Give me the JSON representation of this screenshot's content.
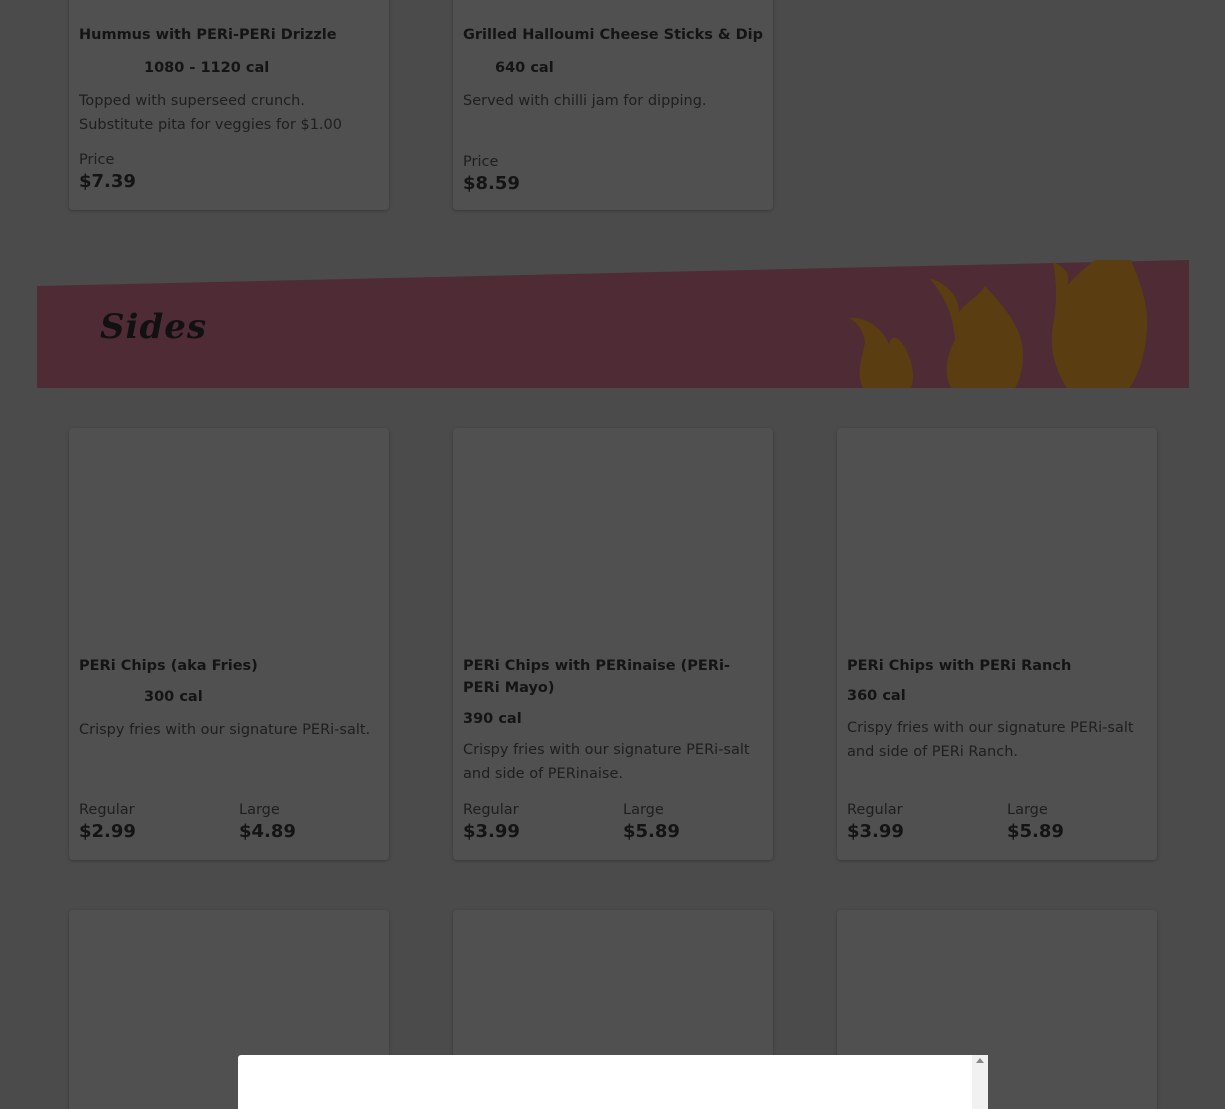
{
  "top_items": [
    {
      "name": "Hummus with PERi-PERi Drizzle",
      "cal": "1080 - 1120 cal",
      "desc": "Topped with superseed crunch. Substitute pita for veggies for $1.00",
      "price_label": "Price",
      "price": "$7.39"
    },
    {
      "name": "Grilled Halloumi Cheese Sticks & Dip",
      "cal": "640 cal",
      "desc": "Served with chilli jam for dipping.",
      "price_label": "Price",
      "price": "$8.59"
    }
  ],
  "sides": {
    "title": "Sides",
    "items": [
      {
        "name": "PERi Chips (aka Fries)",
        "cal": "300 cal",
        "desc": "Crispy fries with our signature PERi-salt.",
        "regular_label": "Regular",
        "regular_price": "$2.99",
        "large_label": "Large",
        "large_price": "$4.89"
      },
      {
        "name": "PERi Chips with PERinaise (PERi-PERi Mayo)",
        "cal": "390 cal",
        "desc": "Crispy fries with our signature PERi-salt and side of PERinaise.",
        "regular_label": "Regular",
        "regular_price": "$3.99",
        "large_label": "Large",
        "large_price": "$5.89"
      },
      {
        "name": "PERi Chips with PERi Ranch",
        "cal": "360 cal",
        "desc": "Crispy fries with our signature PERi-salt and side of PERi Ranch.",
        "regular_label": "Regular",
        "regular_price": "$3.99",
        "large_label": "Large",
        "large_price": "$5.89"
      }
    ]
  },
  "colors": {
    "overlay_background": "#4b4b4b",
    "card_background": "#505050",
    "banner_background": "#4f2b35",
    "flame_color": "#5a3d10",
    "modal_background": "#ffffff"
  },
  "icons": [
    "flame-icon",
    "scroll-up-arrow-icon"
  ]
}
